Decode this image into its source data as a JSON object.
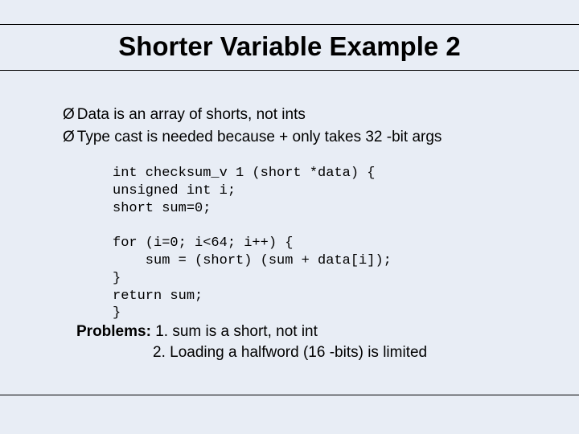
{
  "title": "Shorter Variable Example 2",
  "bullets": [
    {
      "mark": "Ø",
      "text": "Data is an array of shorts, not ints"
    },
    {
      "mark": "Ø",
      "text": "Type cast is needed because + only takes 32 -bit args"
    }
  ],
  "code": "int checksum_v 1 (short *data) {\nunsigned int i;\nshort sum=0;\n\nfor (i=0; i<64; i++) {\n    sum = (short) (sum + data[i]);\n}\nreturn sum;\n}",
  "problems": {
    "label": "Problems:",
    "line1_text": " 1. sum is a short, not int",
    "line2_text": "2. Loading a halfword (16 -bits) is limited"
  }
}
